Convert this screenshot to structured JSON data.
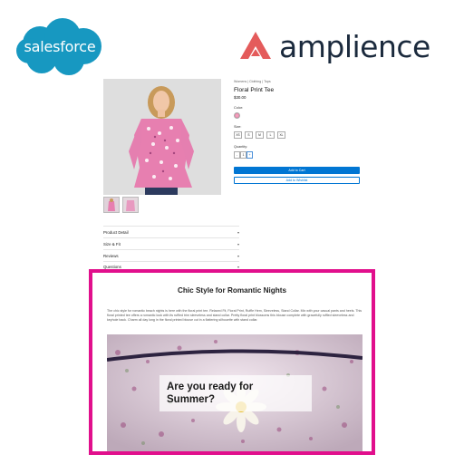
{
  "logos": {
    "salesforce": "salesforce",
    "amplience": "amplience",
    "colors": {
      "salesforce_blue": "#1798c1",
      "amplience_red": "#e45b5b",
      "amplience_navy": "#1b2a3d"
    }
  },
  "product": {
    "breadcrumb": "Womens  |  Clothing  |  Tops",
    "title": "Floral Print Tee",
    "price": "$30.00",
    "color_label": "Color:",
    "size_label": "Size:",
    "sizes": [
      "XS",
      "S",
      "M",
      "L",
      "XL"
    ],
    "quantity_label": "Quantity:",
    "quantity": {
      "minus": "-",
      "value": "1",
      "plus": "+"
    },
    "add_to_cart": "Add to Cart",
    "add_to_wishlist": "Add to Wishlist",
    "accordion": [
      {
        "label": "Product Detail",
        "icon": "chevron-down-icon"
      },
      {
        "label": "Size & Fit",
        "icon": "chevron-down-icon"
      },
      {
        "label": "Reviews",
        "icon": "chevron-down-icon"
      },
      {
        "label": "Questions",
        "icon": "chevron-down-icon"
      }
    ]
  },
  "content_block": {
    "border_color": "#e10f8c",
    "title": "Chic Style for Romantic Nights",
    "body": "The chic style for romantic beach nights is here with the floral print tee. Relaxed Fit, Floral Print, Ruffle Hem, Sleeveless, Stand Collar. Mix with your casual pants and heels. This floral printed tee offers a romantic look with its ruffled trim sleeveless and stand collar. Pretty floral print blossoms this blouse complete with gracefully ruffled sleeveless and keyhole back. Charm all day long in the floral printed blouse cut in a flattering silhouette with stand collar.",
    "hero_heading": "Are you ready for Summer?"
  }
}
